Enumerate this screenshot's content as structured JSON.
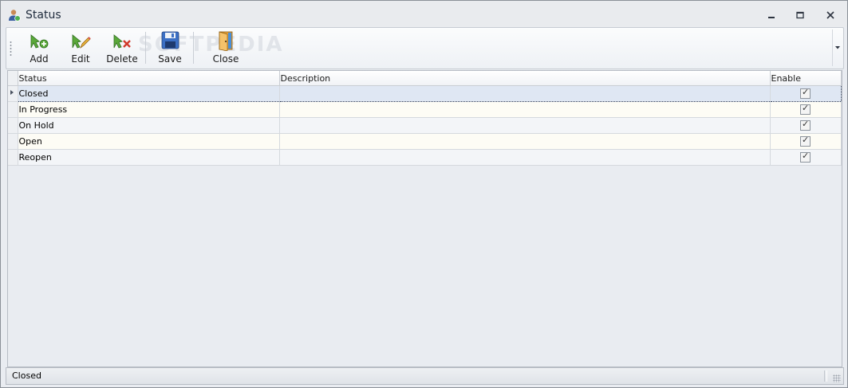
{
  "window": {
    "title": "Status"
  },
  "toolbar": {
    "add_label": "Add",
    "edit_label": "Edit",
    "delete_label": "Delete",
    "save_label": "Save",
    "close_label": "Close",
    "watermark": "SOFTPEDIA"
  },
  "grid": {
    "columns": [
      "Status",
      "Description",
      "Enable"
    ],
    "rows": [
      {
        "status": "Closed",
        "description": "",
        "enable": true
      },
      {
        "status": "In Progress",
        "description": "",
        "enable": true
      },
      {
        "status": "On Hold",
        "description": "",
        "enable": true
      },
      {
        "status": "Open",
        "description": "",
        "enable": true
      },
      {
        "status": "Reopen",
        "description": "",
        "enable": true
      }
    ],
    "selected_row": 0
  },
  "statusbar": {
    "text": "Closed"
  },
  "icons": {
    "app": "user-status-icon",
    "add": "add-icon",
    "edit": "edit-icon",
    "delete": "delete-icon",
    "save": "floppy-disk-icon",
    "close": "door-exit-icon"
  },
  "colors": {
    "accent_green": "#5aa83a",
    "selection": "#dfe7f3"
  }
}
